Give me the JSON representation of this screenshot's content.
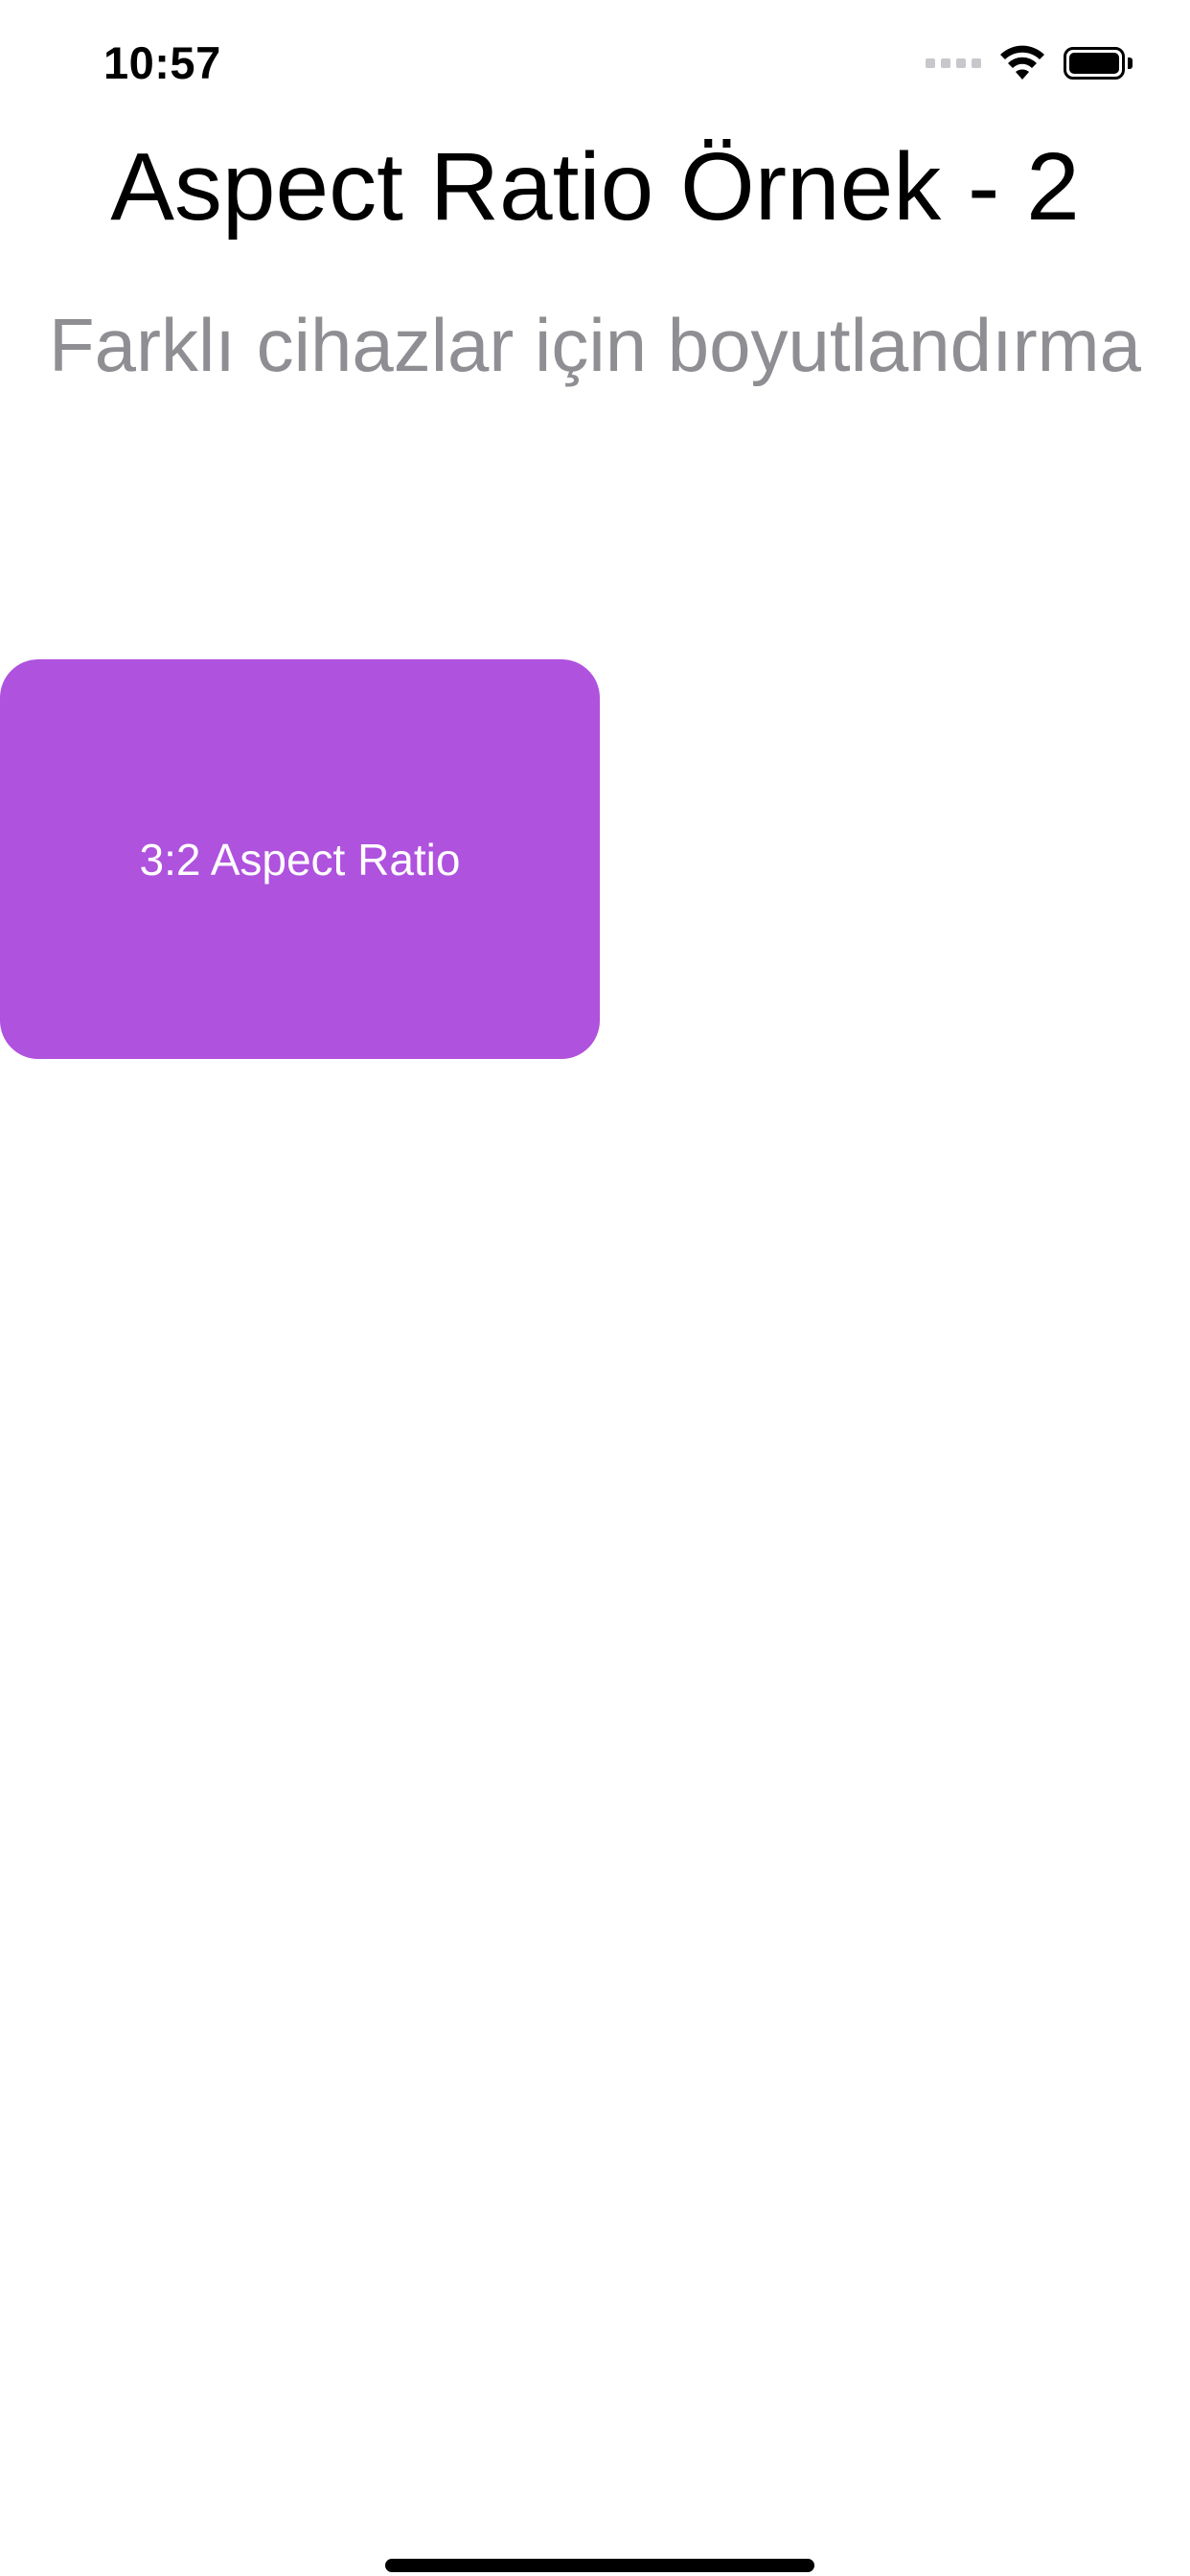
{
  "status_bar": {
    "time": "10:57",
    "signal_icon": "cellular-signal-icon",
    "wifi_icon": "wifi-icon",
    "battery_icon": "battery-icon"
  },
  "header": {
    "title": "Aspect Ratio Örnek - 2",
    "subtitle": "Farklı cihazlar için boyutlandırma"
  },
  "ratio_box": {
    "label": "3:2 Aspect Ratio",
    "color": "#AF52DE"
  },
  "colors": {
    "background": "#FFFFFF",
    "title_text": "#000000",
    "subtitle_text": "#8E8E93",
    "box_text": "#FFFFFF"
  }
}
